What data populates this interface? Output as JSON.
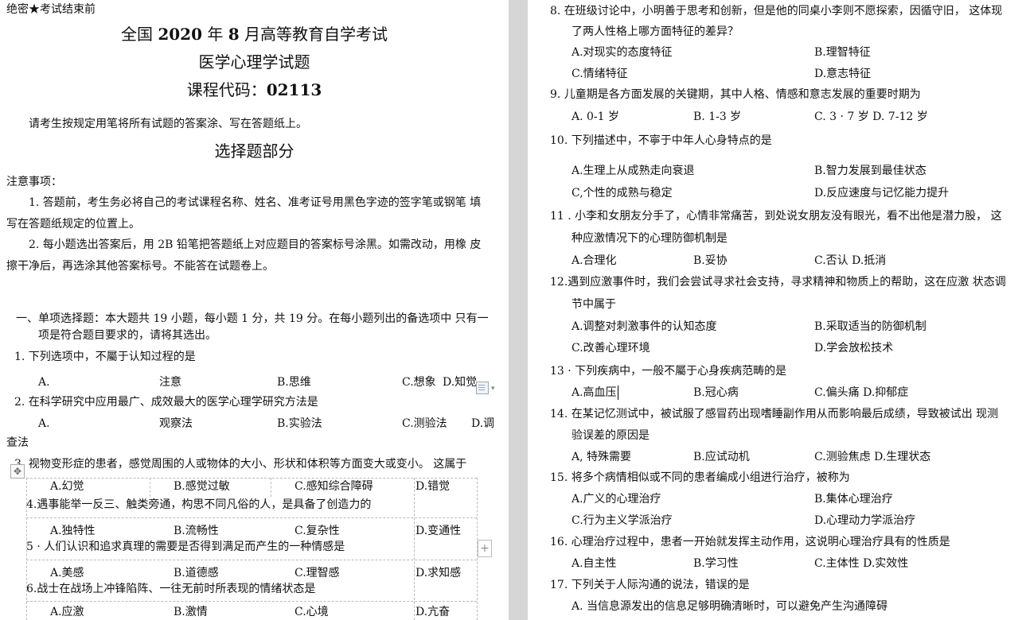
{
  "left": {
    "top_secret": "绝密★考试结束前",
    "heading": {
      "title_pre": "全国 ",
      "year": "2020",
      "title_mid": " 年 ",
      "month": "8",
      "title_post": " 月高等教育自学考试",
      "subject": "医学心理学试题",
      "code_label": "课程代码：",
      "code": "02113"
    },
    "instruction": "请考生按规定用笔将所有试题的答案涂、写在答题纸上。",
    "section_title": "选择题部分",
    "notes_title": "注意事项：",
    "note1_a": "1.   答题前，考生务必将自己的考试课程名称、姓名、准考证号用黑色字迹的签字笔或钢笔 填",
    "note1_b": "写在答题纸规定的位置上。",
    "note2_a": "2.   每小题选出答案后，用 2B 铅笔把答题纸上对应题目的答案标号涂黑。如需改动，用橡 皮",
    "note2_b": "擦干净后，再选涂其他答案标号。不能答在试题卷上。",
    "part1_a": "一、单项选择题：本大题共 19 小题，每小题 1 分，共 19 分。在每小题列出的备选项中  只有一",
    "part1_b": "项是符合题目要求的，请将其选出。",
    "q1": "1.   下列选项中，不屬于认知过程的是",
    "q1_opts": [
      "A.",
      "注意",
      "B.思维",
      "C.想象",
      "D.知觉"
    ],
    "q2": "2.   在科学研究中应用最广、成效最大的医学心理学研究方法是",
    "q2_opts": [
      "A.",
      "观察法",
      "B.实验法",
      "C.测验法",
      "D.调"
    ],
    "q2_wrap": "查法",
    "q3": "3.   视物变形症的患者，感觉周围的人或物体的大小、形状和体积等方面变大或变小。  这属于",
    "q3_opts": [
      "A.幻觉",
      "B.感觉过敏",
      "C.感知综合障碍",
      "D.错觉"
    ],
    "q4": "4.遇事能举一反三、触类旁通，构思不同凡俗的人，是具备了创造力的",
    "q4_opts": [
      "A.独特性",
      "B.流畅性",
      "C.复杂性",
      "D.变通性"
    ],
    "q5": "5 · 人们认识和追求真理的需要是否得到满足而产生的一种情感是",
    "q5_opts": [
      "A.美感",
      "B.道德感",
      "C.理智感",
      "D.求知感"
    ],
    "q6": "6.战士在战场上冲锋陷阵、一往无前时所表现的情绪状态是",
    "q6_opts": [
      "A.应激",
      "B.激情",
      "C.心境",
      "D.亢奋"
    ],
    "move_handle": "✥",
    "add_handle": "+",
    "paste_caret": "▾"
  },
  "right": {
    "q8_a": "8.   在班级讨论中，小明善于思考和创新，但是他的同桌小李则不愿探索，因循守旧，  这体现",
    "q8_b": "了两人性格上哪方面特征的差异？",
    "q8_opts": [
      "A.对现实的态度特征",
      "B.理智特征",
      "C.情绪特征",
      "D.意志特征"
    ],
    "q9": "9.   儿童期是各方面发展的关键期，其中人格、情感和意志发展的重要时期为",
    "q9_opts": [
      "A. 0-1 岁",
      "B. 1-3 岁",
      "C. 3 · 7 岁  D. 7-12 岁"
    ],
    "q10": "10.   下列描述中，不寧于中年人心身特点的是",
    "q10_opts": [
      "A.生理上从成熟走向衰退",
      "B.智力发展到最佳状态",
      "C,个性的成熟与稳定",
      "D.反应速度与记忆能力提升"
    ],
    "q11_a": "11 . 小李和女朋友分手了，心情非常痛苦，到处说女朋友没有眼光，看不出他是潜力股，  这",
    "q11_b": "种应激情况下的心理防御机制是",
    "q11_opts": [
      "A.合理化",
      "B.妥协",
      "C.否认  D.抵消"
    ],
    "q12_a": "12.遇到应激事件时，我们会尝试寻求社会支持，寻求精神和物质上的帮助，这在应激  状态调",
    "q12_b": "节中属于",
    "q12_opts": [
      "A.调整对刺激事件的认知态度",
      "B.采取适当的防御机制",
      "C.改善心理环境",
      "D.学会放松技术"
    ],
    "q13": "13 · 下列疾病中，一般不屬于心身疾病范畴的是",
    "q13_opts": [
      "A.高血压",
      "B.冠心病",
      "C.偏头痛  D.抑郁症"
    ],
    "q14_a": "14.   在某记忆测试中，被试服了感冒药出现嗜睡副作用从而影响最后成绩，导致被试出  现测",
    "q14_b": "验误差的原因是",
    "q14_opts": [
      "A, 特殊需要",
      "B.应试动机",
      "C.测验焦虑  D.生理状态"
    ],
    "q15": "15.    将多个病情相似或不同的患者编成小组进行治疗，被称为",
    "q15_opts": [
      "A.广义的心理治疗",
      "B.集体心理治疗",
      "C.行为主义学派治疗",
      "D.心理动力学派治疗"
    ],
    "q16": "16.    心理治疗过程中，患者一开始就发挥主动作用，这说明心理治疗具有的性质是",
    "q16_opts": [
      "A.自主性",
      "B.学习性",
      "C.主体性  D.实效性"
    ],
    "q17": "17.    下列关于人际沟通的说法，错误的是",
    "q17_a": "A.    当信息源发出的信息足够明确清晰时，可以避免产生沟通障碍"
  }
}
